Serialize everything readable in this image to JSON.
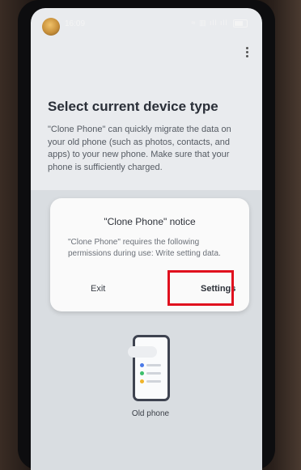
{
  "status_bar": {
    "time": "16:09",
    "icons": "≈ ▥ ıll ıll"
  },
  "page": {
    "title": "Select current device type",
    "description": "\"Clone Phone\" can quickly migrate the data on your old phone (such as photos, contacts, and apps) to your new phone. Make sure that your phone is sufficiently charged."
  },
  "device_option": {
    "label": "Old phone"
  },
  "dialog": {
    "title": "\"Clone Phone\" notice",
    "body": "\"Clone Phone\" requires the following permissions during use: Write setting data.",
    "exit_label": "Exit",
    "settings_label": "Settings"
  },
  "colors": {
    "highlight": "#e0101e",
    "screen_bg": "#e9ebee"
  }
}
